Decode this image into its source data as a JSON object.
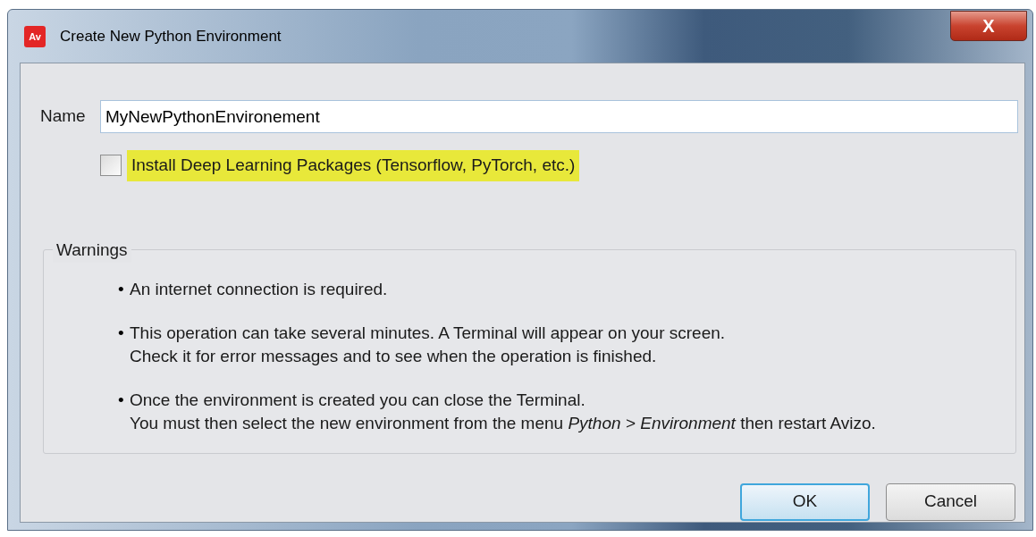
{
  "window": {
    "title": "Create New Python Environment",
    "app_badge": "Av",
    "close_glyph": "X"
  },
  "name_field": {
    "label": "Name",
    "value": "MyNewPythonEnvironement"
  },
  "deep_learning_option": {
    "label": "Install Deep Learning Packages (Tensorflow, PyTorch, etc.)",
    "checked": false,
    "highlighted": true
  },
  "warnings": {
    "title": "Warnings",
    "items": [
      {
        "bullet": "•",
        "lines": [
          "An internet connection is required."
        ]
      },
      {
        "bullet": "•",
        "lines": [
          "This operation can take several minutes. A Terminal will appear on your screen.",
          "Check it for error messages and to see when the operation is finished."
        ]
      },
      {
        "bullet": "•",
        "lines": [
          "Once the environment is created you can close the Terminal.",
          "You must then select the new environment from the menu *Python > Environment* then restart Avizo."
        ]
      }
    ]
  },
  "buttons": [
    {
      "label": "OK",
      "default": true
    },
    {
      "label": "Cancel",
      "default": false
    }
  ]
}
